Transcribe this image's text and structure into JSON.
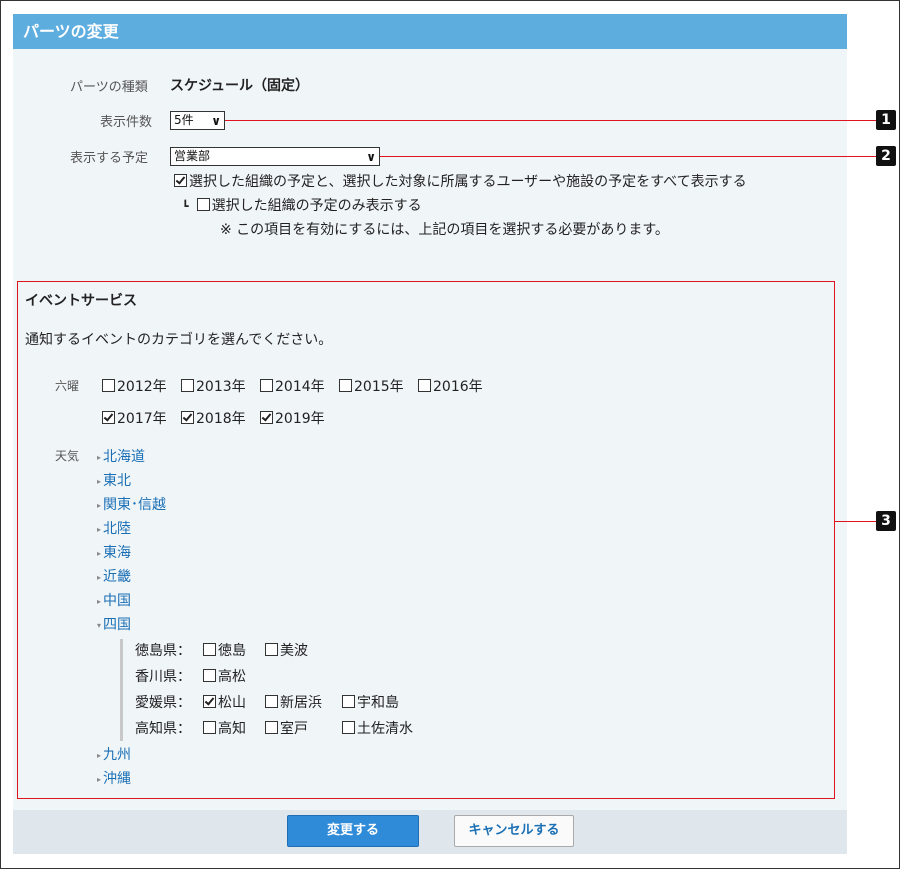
{
  "title": "パーツの変更",
  "parts_type": {
    "label": "パーツの種類",
    "value": "スケジュール（固定）"
  },
  "display_count": {
    "label": "表示件数",
    "selected": "5件"
  },
  "display_schedule": {
    "label": "表示する予定",
    "selected": "営業部",
    "option_all": "選択した組織の予定と、選択した対象に所属するユーザーや施設の予定をすべて表示する",
    "option_only_marker": "┗",
    "option_only": "選択した組織の予定のみ表示する",
    "note": "※ この項目を有効にするには、上記の項目を選択する必要があります。"
  },
  "event_service": {
    "heading": "イベントサービス",
    "instruction": "通知するイベントのカテゴリを選んでください。",
    "rokuyo": {
      "label": "六曜",
      "years": [
        {
          "label": "2012年",
          "checked": false
        },
        {
          "label": "2013年",
          "checked": false
        },
        {
          "label": "2014年",
          "checked": false
        },
        {
          "label": "2015年",
          "checked": false
        },
        {
          "label": "2016年",
          "checked": false
        },
        {
          "label": "2017年",
          "checked": true
        },
        {
          "label": "2018年",
          "checked": true
        },
        {
          "label": "2019年",
          "checked": true
        }
      ]
    },
    "weather": {
      "label": "天気",
      "regions": [
        "北海道",
        "東北",
        "関東･信越",
        "北陸",
        "東海",
        "近畿",
        "中国",
        "四国",
        "九州",
        "沖縄"
      ],
      "shikoku": [
        {
          "pref": "徳島県：",
          "cities": [
            {
              "label": "徳島",
              "checked": false
            },
            {
              "label": "美波",
              "checked": false
            }
          ]
        },
        {
          "pref": "香川県：",
          "cities": [
            {
              "label": "高松",
              "checked": false
            }
          ]
        },
        {
          "pref": "愛媛県：",
          "cities": [
            {
              "label": "松山",
              "checked": true
            },
            {
              "label": "新居浜",
              "checked": false
            },
            {
              "label": "宇和島",
              "checked": false
            }
          ]
        },
        {
          "pref": "高知県：",
          "cities": [
            {
              "label": "高知",
              "checked": false
            },
            {
              "label": "室戸",
              "checked": false
            },
            {
              "label": "土佐清水",
              "checked": false
            }
          ]
        }
      ]
    }
  },
  "buttons": {
    "submit": "変更する",
    "cancel": "キャンセルする"
  },
  "callouts": [
    "1",
    "2",
    "3"
  ],
  "colors": {
    "title_bar": "#5eaddf",
    "primary_button": "#2f8ad8",
    "callout": "#e0141e",
    "link": "#1a6fb5"
  }
}
